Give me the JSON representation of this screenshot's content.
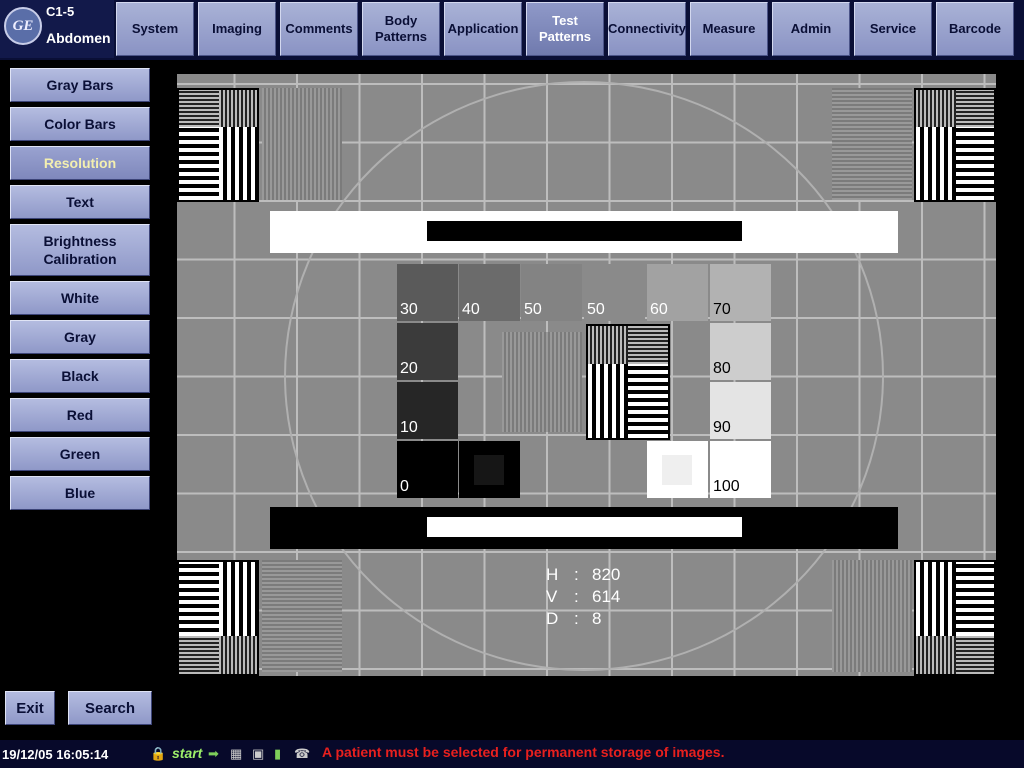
{
  "probe": {
    "logo": "GE",
    "name": "C1-5",
    "preset": "Abdomen"
  },
  "top_menu": [
    {
      "label": "System",
      "active": false
    },
    {
      "label": "Imaging",
      "active": false
    },
    {
      "label": "Comments",
      "active": false
    },
    {
      "label": "Body\nPatterns",
      "active": false
    },
    {
      "label": "Application",
      "active": false
    },
    {
      "label": "Test\nPatterns",
      "active": true
    },
    {
      "label": "Connectivity",
      "active": false
    },
    {
      "label": "Measure",
      "active": false
    },
    {
      "label": "Admin",
      "active": false
    },
    {
      "label": "Service",
      "active": false
    },
    {
      "label": "Barcode",
      "active": false
    }
  ],
  "side_buttons": [
    {
      "label": "Gray Bars",
      "active": false
    },
    {
      "label": "Color Bars",
      "active": false
    },
    {
      "label": "Resolution",
      "active": true
    },
    {
      "label": "Text",
      "active": false
    },
    {
      "label": "Brightness\nCalibration",
      "active": false
    },
    {
      "label": "White",
      "active": false
    },
    {
      "label": "Gray",
      "active": false
    },
    {
      "label": "Black",
      "active": false
    },
    {
      "label": "Red",
      "active": false
    },
    {
      "label": "Green",
      "active": false
    },
    {
      "label": "Blue",
      "active": false
    }
  ],
  "bottom_buttons": {
    "exit": "Exit",
    "search": "Search"
  },
  "gray_scale": {
    "row1": [
      "30",
      "40",
      "50",
      "50",
      "60",
      "70"
    ],
    "col_left": [
      "20",
      "10"
    ],
    "col_right": [
      "80",
      "90"
    ],
    "row4_left": "0",
    "row4_right": "100"
  },
  "resolution_info": [
    {
      "key": "H",
      "sep": ":",
      "value": "820"
    },
    {
      "key": "V",
      "sep": ":",
      "value": "614"
    },
    {
      "key": "D",
      "sep": ":",
      "value": "8"
    }
  ],
  "status_bar": {
    "datetime": "19/12/05 16:05:14",
    "start_label": "start",
    "message": "A patient must be selected for permanent storage of images.",
    "colors": {
      "message": "#e8201e",
      "start": "#9ef06a"
    },
    "icons": [
      "lock-icon",
      "transfer-icon",
      "network-disconnected-icon",
      "network-offline-icon",
      "battery-icon",
      "phone-icon"
    ]
  },
  "colors": {
    "accent": "#0a0f36",
    "button": "#a4acd6",
    "active_text": "#f3efb0"
  }
}
